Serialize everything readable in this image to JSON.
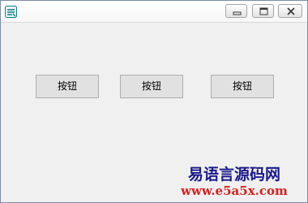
{
  "window": {
    "title": "",
    "app_icon": "app-logo-icon",
    "controls": {
      "minimize_icon": "minimize-icon",
      "maximize_icon": "maximize-icon",
      "close_icon": "close-icon"
    }
  },
  "buttons": [
    {
      "label": "按钮"
    },
    {
      "label": "按钮"
    },
    {
      "label": "按钮"
    }
  ],
  "watermark": {
    "title": "易语言源码网",
    "url": "www.e5a5x.com"
  },
  "colors": {
    "window_bg": "#f0f0f0",
    "button_bg": "#e1e1e1",
    "watermark_title": "#1a1a8c",
    "watermark_url": "#d81e1e"
  }
}
